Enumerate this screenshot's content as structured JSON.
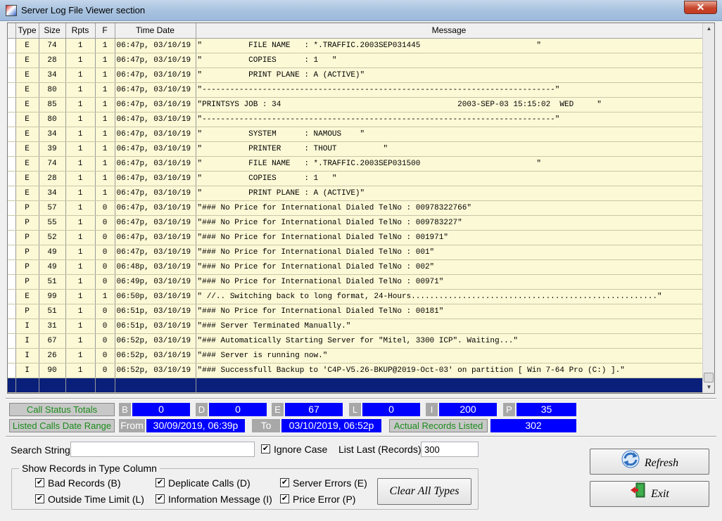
{
  "window": {
    "title": "Server Log File Viewer  section",
    "close_glyph": "✕"
  },
  "grid": {
    "columns": [
      "Type",
      "Size",
      "Rpts",
      "F",
      "Time Date",
      "Message"
    ],
    "rows": [
      {
        "type": "E",
        "size": "74",
        "rpts": "1",
        "f": "1",
        "time": "06:47p, 03/10/19",
        "msg": "\"          FILE NAME   : *.TRAFFIC.2003SEP031445                         \""
      },
      {
        "type": "E",
        "size": "28",
        "rpts": "1",
        "f": "1",
        "time": "06:47p, 03/10/19",
        "msg": "\"          COPIES      : 1   \""
      },
      {
        "type": "E",
        "size": "34",
        "rpts": "1",
        "f": "1",
        "time": "06:47p, 03/10/19",
        "msg": "\"          PRINT PLANE : A (ACTIVE)\""
      },
      {
        "type": "E",
        "size": "80",
        "rpts": "1",
        "f": "1",
        "time": "06:47p, 03/10/19",
        "msg": "\"----------------------------------------------------------------------------\""
      },
      {
        "type": "E",
        "size": "85",
        "rpts": "1",
        "f": "1",
        "time": "06:47p, 03/10/19",
        "msg": "\"PRINTSYS JOB : 34                                      2003-SEP-03 15:15:02  WED     \""
      },
      {
        "type": "E",
        "size": "80",
        "rpts": "1",
        "f": "1",
        "time": "06:47p, 03/10/19",
        "msg": "\"----------------------------------------------------------------------------\""
      },
      {
        "type": "E",
        "size": "34",
        "rpts": "1",
        "f": "1",
        "time": "06:47p, 03/10/19",
        "msg": "\"          SYSTEM      : NAMOUS    \""
      },
      {
        "type": "E",
        "size": "39",
        "rpts": "1",
        "f": "1",
        "time": "06:47p, 03/10/19",
        "msg": "\"          PRINTER     : THOUT          \""
      },
      {
        "type": "E",
        "size": "74",
        "rpts": "1",
        "f": "1",
        "time": "06:47p, 03/10/19",
        "msg": "\"          FILE NAME   : *.TRAFFIC.2003SEP031500                         \""
      },
      {
        "type": "E",
        "size": "28",
        "rpts": "1",
        "f": "1",
        "time": "06:47p, 03/10/19",
        "msg": "\"          COPIES      : 1   \""
      },
      {
        "type": "E",
        "size": "34",
        "rpts": "1",
        "f": "1",
        "time": "06:47p, 03/10/19",
        "msg": "\"          PRINT PLANE : A (ACTIVE)\""
      },
      {
        "type": "P",
        "size": "57",
        "rpts": "1",
        "f": "0",
        "time": "06:47p, 03/10/19",
        "msg": "\"### No Price for International Dialed TelNo : 00978322766\""
      },
      {
        "type": "P",
        "size": "55",
        "rpts": "1",
        "f": "0",
        "time": "06:47p, 03/10/19",
        "msg": "\"### No Price for International Dialed TelNo : 009783227\""
      },
      {
        "type": "P",
        "size": "52",
        "rpts": "1",
        "f": "0",
        "time": "06:47p, 03/10/19",
        "msg": "\"### No Price for International Dialed TelNo : 001971\""
      },
      {
        "type": "P",
        "size": "49",
        "rpts": "1",
        "f": "0",
        "time": "06:47p, 03/10/19",
        "msg": "\"### No Price for International Dialed TelNo : 001\""
      },
      {
        "type": "P",
        "size": "49",
        "rpts": "1",
        "f": "0",
        "time": "06:48p, 03/10/19",
        "msg": "\"### No Price for International Dialed TelNo : 002\""
      },
      {
        "type": "P",
        "size": "51",
        "rpts": "1",
        "f": "0",
        "time": "06:49p, 03/10/19",
        "msg": "\"### No Price for International Dialed TelNo : 00971\""
      },
      {
        "type": "E",
        "size": "99",
        "rpts": "1",
        "f": "1",
        "time": "06:50p, 03/10/19",
        "msg": "\" //.. Switching back to long format, 24-Hours.....................................................\""
      },
      {
        "type": "P",
        "size": "51",
        "rpts": "1",
        "f": "0",
        "time": "06:51p, 03/10/19",
        "msg": "\"### No Price for International Dialed TelNo : 00181\""
      },
      {
        "type": "I",
        "size": "31",
        "rpts": "1",
        "f": "0",
        "time": "06:51p, 03/10/19",
        "msg": "\"### Server Terminated Manually.\""
      },
      {
        "type": "I",
        "size": "67",
        "rpts": "1",
        "f": "0",
        "time": "06:52p, 03/10/19",
        "msg": "\"### Automatically Starting Server for \"Mitel, 3300 ICP\". Waiting...\""
      },
      {
        "type": "I",
        "size": "26",
        "rpts": "1",
        "f": "0",
        "time": "06:52p, 03/10/19",
        "msg": "\"### Server is running now.\""
      },
      {
        "type": "I",
        "size": "90",
        "rpts": "1",
        "f": "0",
        "time": "06:52p, 03/10/19",
        "msg": "\"### Successfull Backup to 'C4P-V5.26-BKUP@2019-Oct-03' on partition [ Win 7-64 Pro (C:) ].\""
      }
    ]
  },
  "totals": {
    "label": "Call Status Totals",
    "items": [
      {
        "key": "B",
        "value": "0"
      },
      {
        "key": "D",
        "value": "0"
      },
      {
        "key": "E",
        "value": "67"
      },
      {
        "key": "L",
        "value": "0"
      },
      {
        "key": "I",
        "value": "200"
      },
      {
        "key": "P",
        "value": "35"
      }
    ]
  },
  "range": {
    "label": "Listed Calls Date Range",
    "from_label": "From",
    "from_value": "30/09/2019, 06:39p",
    "to_label": "To",
    "to_value": "03/10/2019, 06:52p",
    "actual_label": "Actual Records Listed",
    "actual_value": "302"
  },
  "search": {
    "label": "Search String",
    "value": "",
    "ignore_case_label": "Ignore Case",
    "ignore_case_checked": true,
    "list_last_label": "List Last (Records)",
    "list_last_value": "300"
  },
  "types": {
    "title": "Show Records in Type Column",
    "options": [
      {
        "label": "Bad Records (B)",
        "checked": true
      },
      {
        "label": "Deplicate Calls (D)",
        "checked": true
      },
      {
        "label": "Server Errors (E)",
        "checked": true
      },
      {
        "label": "Outside Time Limit (L)",
        "checked": true
      },
      {
        "label": "Information Message (I)",
        "checked": true
      },
      {
        "label": "Price Error (P)",
        "checked": true
      }
    ],
    "clear_label": "Clear All Types"
  },
  "buttons": {
    "refresh_label": "Refresh",
    "exit_label": "Exit"
  }
}
